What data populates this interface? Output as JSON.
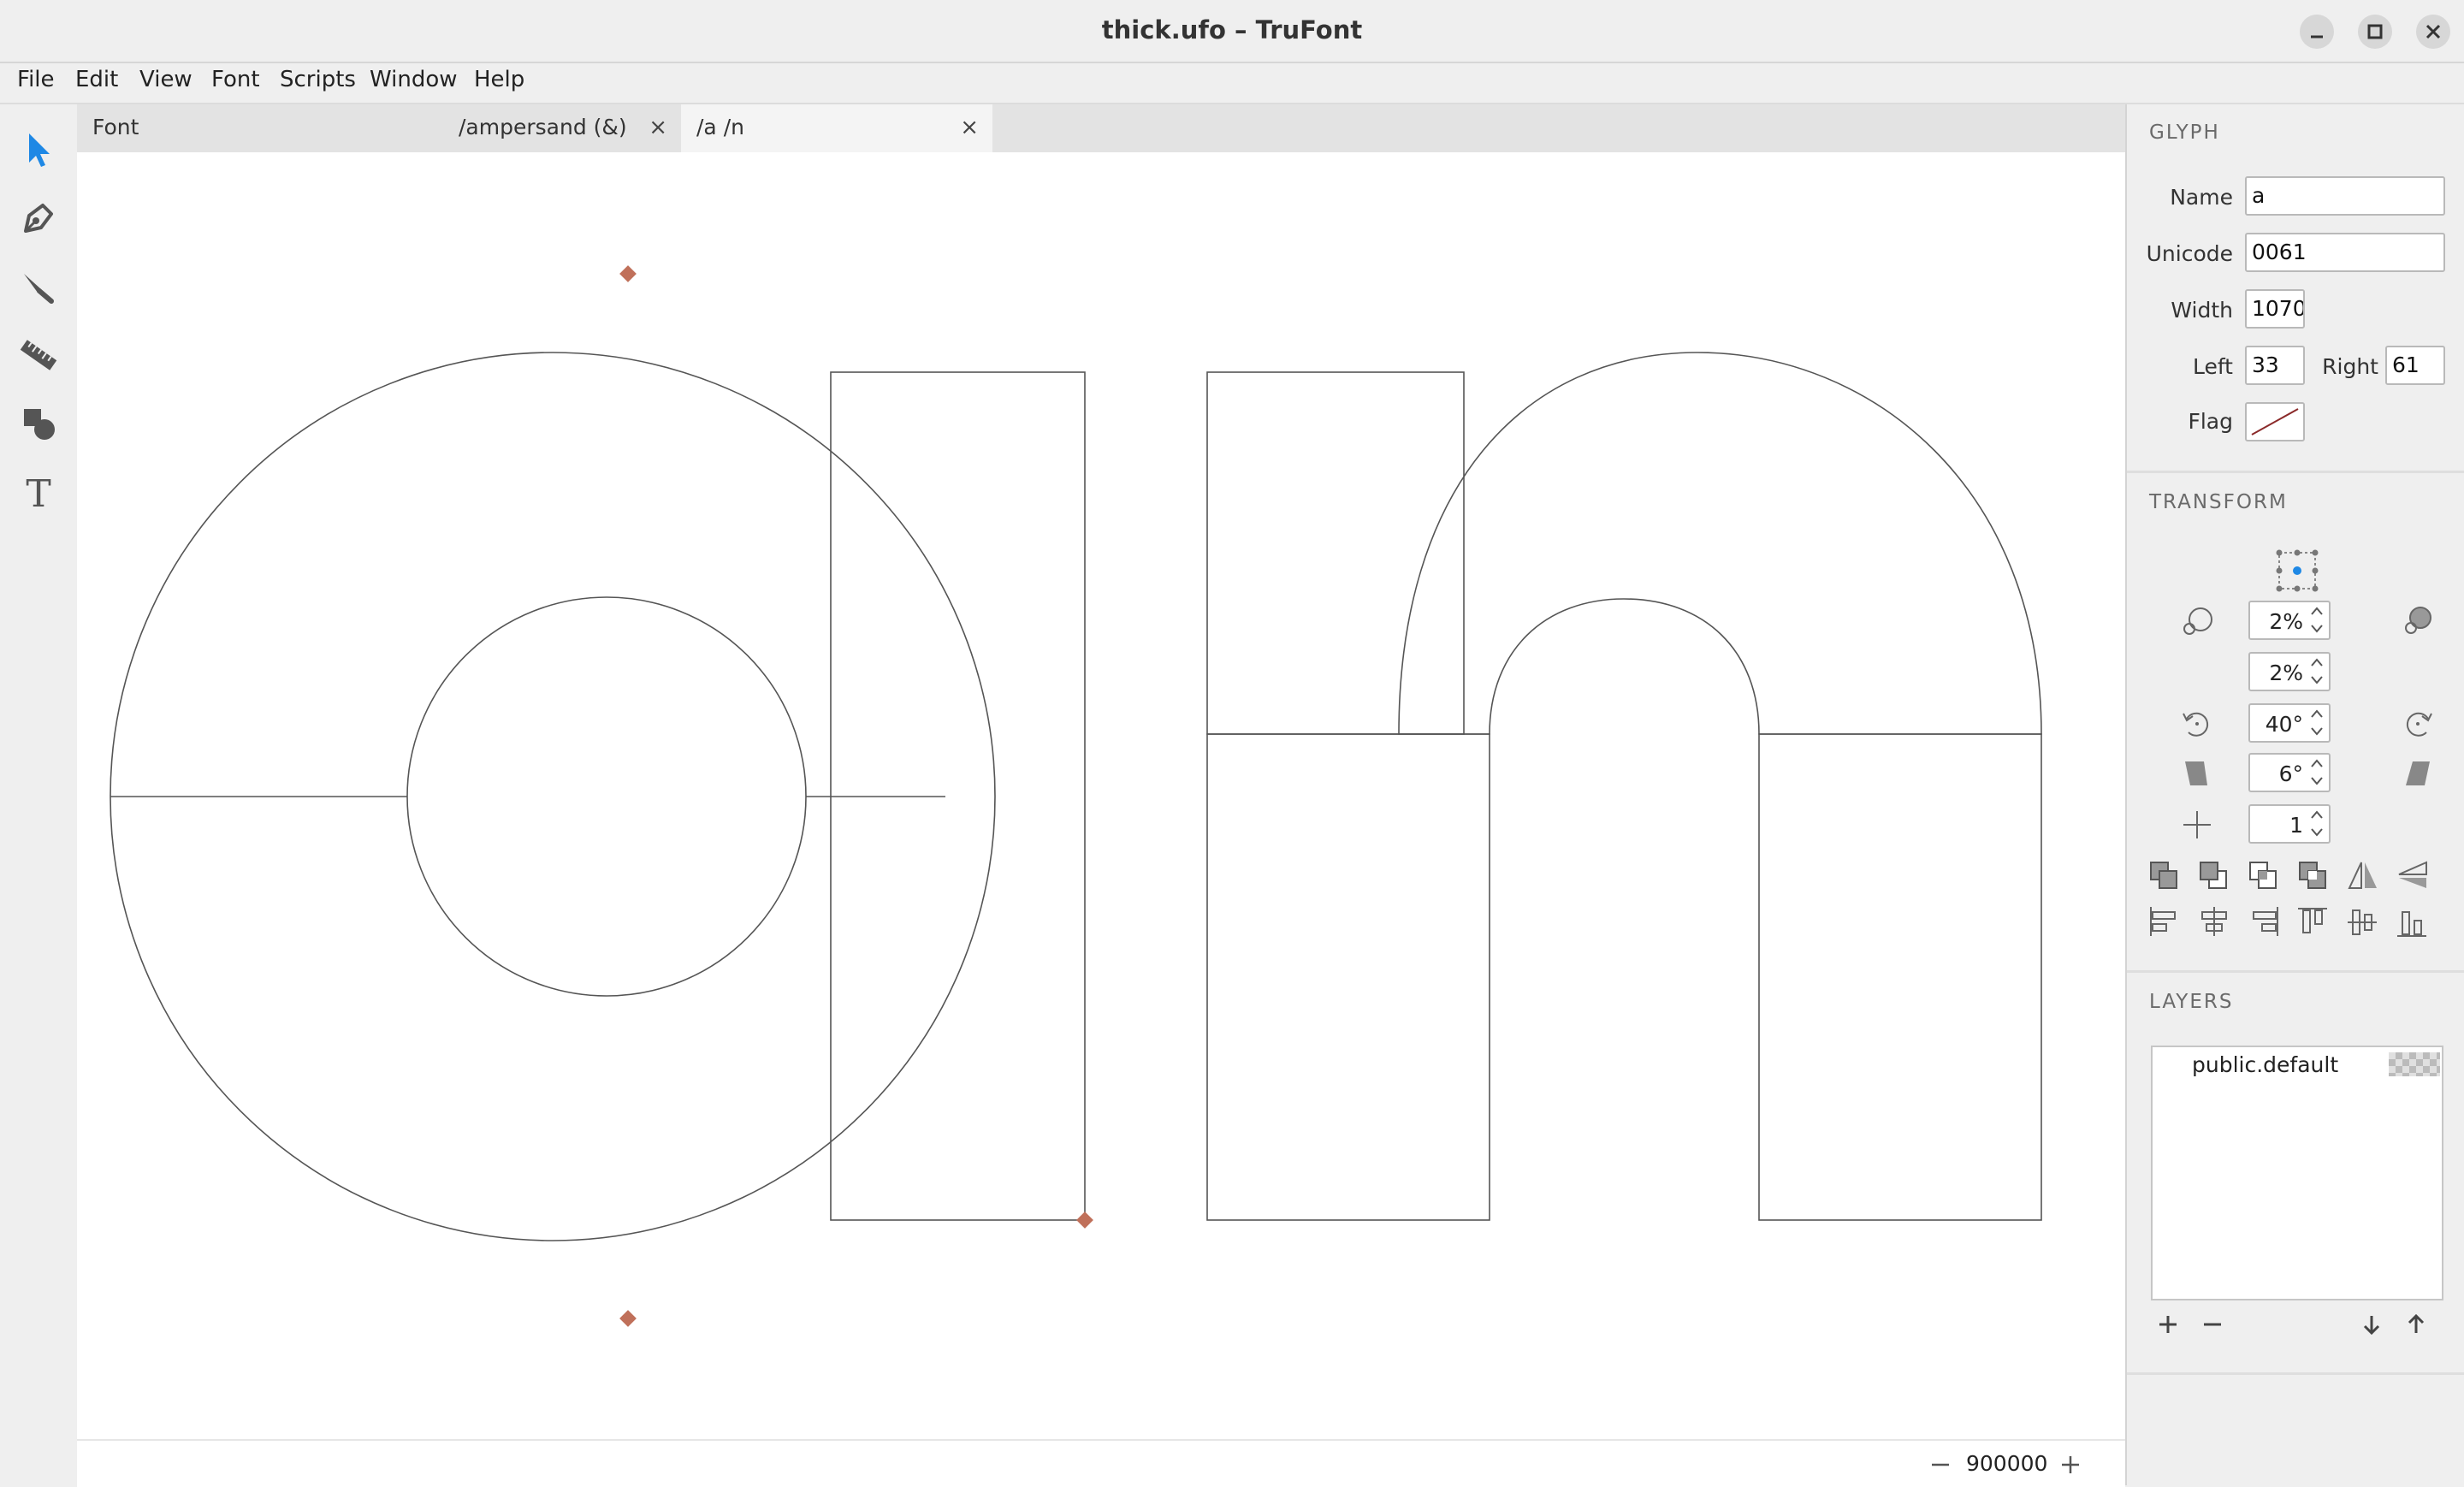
{
  "window": {
    "title": "thick.ufo – TruFont"
  },
  "menu": [
    {
      "label": "File"
    },
    {
      "label": "Edit"
    },
    {
      "label": "View"
    },
    {
      "label": "Font"
    },
    {
      "label": "Scripts"
    },
    {
      "label": "Window"
    },
    {
      "label": "Help"
    }
  ],
  "tools": [
    "selection-tool",
    "pen-tool",
    "knife-tool",
    "ruler-tool",
    "shapes-tool",
    "text-tool"
  ],
  "tabs": [
    {
      "label": "Font",
      "closable": false
    },
    {
      "label": "/ampersand (&)",
      "closable": true
    },
    {
      "label": "/a /n",
      "closable": true,
      "active": true
    }
  ],
  "tab_close_glyph": "×",
  "statusbar": {
    "zoom_value": "900000 pt"
  },
  "glyph": {
    "header": "GLYPH",
    "name_label": "Name",
    "name_value": "a",
    "unicode_label": "Unicode",
    "unicode_value": "0061",
    "width_label": "Width",
    "width_value": "1070",
    "left_label": "Left",
    "left_value": "33",
    "right_label": "Right",
    "right_value": "61",
    "flag_label": "Flag"
  },
  "transform": {
    "header": "TRANSFORM",
    "scale_x": "2%",
    "scale_y": "2%",
    "rotate": "40°",
    "skew": "6°",
    "move": "1"
  },
  "layers": {
    "header": "LAYERS",
    "items": [
      {
        "label": "public.default"
      }
    ]
  },
  "colors": {
    "accent": "#1e88e5",
    "anchor": "#c0705a",
    "outline": "#555555"
  }
}
